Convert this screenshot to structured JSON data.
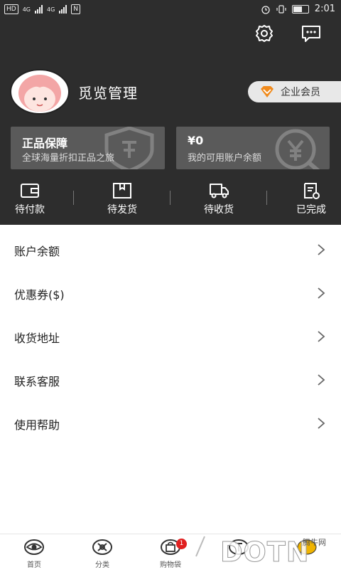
{
  "status_bar": {
    "carrier_badge": "HD",
    "signal_1": "4G",
    "signal_2": "4G",
    "nfc": "N",
    "time": "2:01"
  },
  "profile": {
    "name": "觅览管理",
    "vip_label": "企业会员"
  },
  "cards": [
    {
      "title": "正品保障",
      "subtitle": "全球海量折扣正品之旅"
    },
    {
      "title": "¥0",
      "subtitle": "我的可用账户余额"
    }
  ],
  "orders": [
    {
      "label": "待付款",
      "icon": "wallet-icon"
    },
    {
      "label": "待发货",
      "icon": "package-icon"
    },
    {
      "label": "待收货",
      "icon": "truck-icon"
    },
    {
      "label": "已完成",
      "icon": "receipt-icon"
    }
  ],
  "menu": [
    {
      "label": "账户余额"
    },
    {
      "label": "优惠券($)"
    },
    {
      "label": "收货地址"
    },
    {
      "label": "联系客服"
    },
    {
      "label": "使用帮助"
    }
  ],
  "tabs": [
    {
      "label": "首页",
      "icon": "eye-icon"
    },
    {
      "label": "分类",
      "icon": "category-icon"
    },
    {
      "label": "购物袋",
      "icon": "shopping-bag-icon",
      "badge": "1"
    },
    {
      "label": "",
      "icon": "text-icon"
    },
    {
      "label": "",
      "icon": "profile-icon"
    }
  ],
  "watermark": {
    "text": "DOTN",
    "site": "腾牛网"
  },
  "colors": {
    "header_bg": "#2d2d2d",
    "card_bg": "#5a5a5a",
    "vip_accent": "#f08a1c",
    "badge": "#e02020"
  }
}
